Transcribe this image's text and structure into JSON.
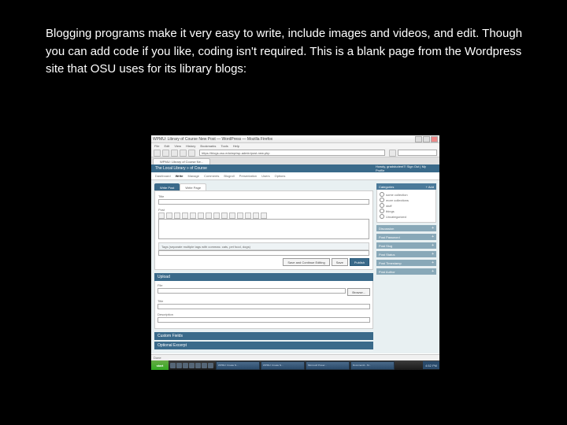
{
  "caption": "Blogging programs make it very easy to write, include images and videos, and edit.  Though you can add code if you like, coding isn't required.  This is a blank page from the Wordpress site that OSU uses for its library blogs:",
  "window": {
    "title": "WPMU: Library of Course New Post — WordPress — Mozilla Firefox",
    "menu": [
      "File",
      "Edit",
      "View",
      "History",
      "Bookmarks",
      "Tools",
      "Help"
    ],
    "url": "https://blogs.osu.edu/wp/wp-admin/post-new.php",
    "tab": "WPMU: Library of Course Ne..."
  },
  "header": {
    "site": "The Local Library » of Course",
    "greeting": "Howdy, gradstudent7!",
    "links": "Sign Out | My Profile"
  },
  "nav": {
    "items": [
      "Dashboard",
      "Write",
      "Manage",
      "Comments",
      "Blogroll",
      "Presentation",
      "Users",
      "Options"
    ],
    "active": "Write"
  },
  "write": {
    "tabs": [
      "Write Post",
      "Write Page"
    ],
    "title_lbl": "Title",
    "post_lbl": "Post",
    "tags_lbl": "Tags (separate multiple tags with commas: cats, pet food, dogs)",
    "save_continue": "Save and Continue Editing",
    "save": "Save",
    "publish": "Publish"
  },
  "upload": {
    "header": "Upload",
    "file_lbl": "File",
    "title_lbl": "Title",
    "desc_lbl": "Description",
    "browse": "Browse..."
  },
  "collapsed": [
    "Custom Fields",
    "Optional Excerpt"
  ],
  "sidebar": {
    "cat_hdr": "Categories",
    "cat_add": "+ Add",
    "cats": [
      "some collection",
      "more collections",
      "stuff",
      "things",
      "Uncategorized"
    ],
    "boxes": [
      "Discussion",
      "Post Password",
      "Post Slug",
      "Post Status",
      "Post Timestamp",
      "Post Author"
    ]
  },
  "taskbar": {
    "start": "start",
    "tasks": [
      "WPMU: Create N...",
      "WPMU: Create N...",
      "Microsoft Power...",
      "Document1 - M..."
    ],
    "time": "4:52 PM"
  },
  "status": "Done"
}
